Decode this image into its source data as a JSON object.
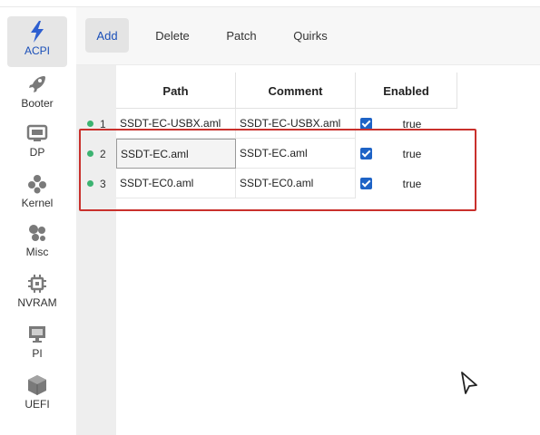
{
  "sidebar": {
    "items": [
      {
        "label": "ACPI",
        "icon": "acpi-bolt-icon",
        "active": true
      },
      {
        "label": "Booter",
        "icon": "rocket-icon",
        "active": false
      },
      {
        "label": "DP",
        "icon": "device-properties-icon",
        "active": false
      },
      {
        "label": "Kernel",
        "icon": "kernel-icon",
        "active": false
      },
      {
        "label": "Misc",
        "icon": "misc-icon",
        "active": false
      },
      {
        "label": "NVRAM",
        "icon": "chip-icon",
        "active": false
      },
      {
        "label": "PI",
        "icon": "monitor-icon",
        "active": false
      },
      {
        "label": "UEFI",
        "icon": "cube-icon",
        "active": false
      }
    ]
  },
  "tabs": [
    {
      "label": "Add",
      "active": true
    },
    {
      "label": "Delete",
      "active": false
    },
    {
      "label": "Patch",
      "active": false
    },
    {
      "label": "Quirks",
      "active": false
    }
  ],
  "table": {
    "columns": [
      "Path",
      "Comment",
      "Enabled"
    ],
    "rows": [
      {
        "index": "1",
        "path": "SSDT-EC-USBX.aml",
        "comment": "SSDT-EC-USBX.aml",
        "enabled": "true"
      },
      {
        "index": "2",
        "path": "SSDT-EC.aml",
        "comment": "SSDT-EC.aml",
        "enabled": "true"
      },
      {
        "index": "3",
        "path": "SSDT-EC0.aml",
        "comment": "SSDT-EC0.aml",
        "enabled": "true"
      }
    ]
  },
  "colors": {
    "accent": "#1a4fb8",
    "checkbox": "#1e63c6",
    "status_dot": "#3cb371",
    "highlight_border": "#c9302c"
  }
}
